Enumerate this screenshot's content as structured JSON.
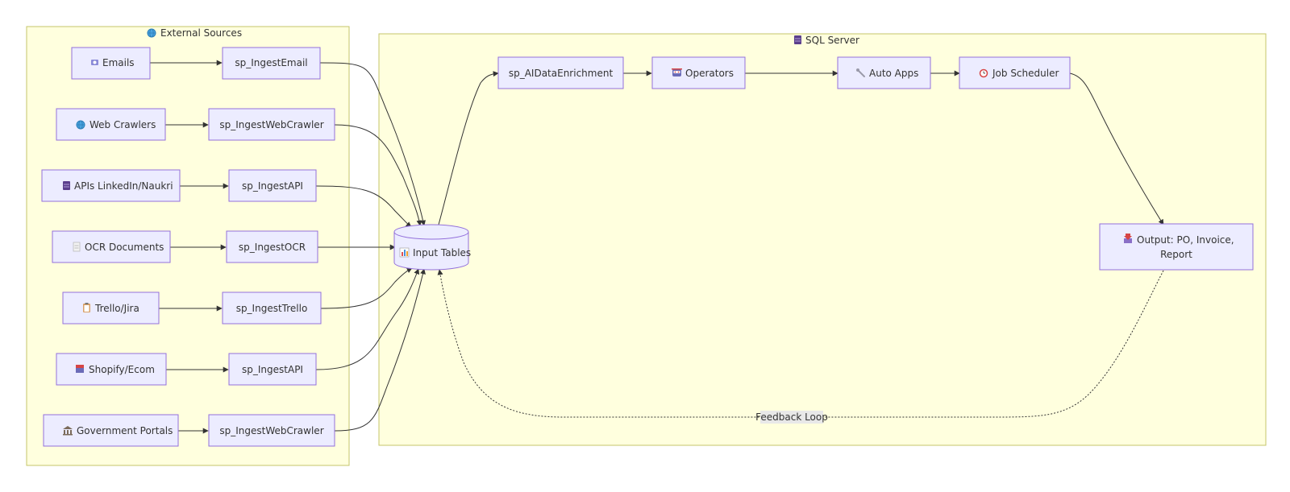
{
  "clusters": {
    "external": {
      "label": "External Sources",
      "icon": "globe-icon"
    },
    "sql": {
      "label": "SQL Server",
      "icon": "server-icon"
    }
  },
  "sources": [
    {
      "label": "Emails",
      "icon": "email-icon"
    },
    {
      "label": "Web Crawlers",
      "icon": "globe-icon"
    },
    {
      "label": "APIs LinkedIn/Naukri",
      "icon": "server-icon"
    },
    {
      "label": "OCR Documents",
      "icon": "document-icon"
    },
    {
      "label": "Trello/Jira",
      "icon": "clipboard-icon"
    },
    {
      "label": "Shopify/Ecom",
      "icon": "store-icon"
    },
    {
      "label": "Government Portals",
      "icon": "bank-icon"
    }
  ],
  "ingest": [
    {
      "label": "sp_IngestEmail"
    },
    {
      "label": "sp_IngestWebCrawler"
    },
    {
      "label": "sp_IngestAPI"
    },
    {
      "label": "sp_IngestOCR"
    },
    {
      "label": "sp_IngestTrello"
    },
    {
      "label": "sp_IngestAPI"
    },
    {
      "label": "sp_IngestWebCrawler"
    }
  ],
  "input_tables": {
    "label": "Input Tables",
    "icon": "bar-chart-icon"
  },
  "pipeline": [
    {
      "label": "sp_AIDataEnrichment"
    },
    {
      "label": "Operators",
      "icon": "robot-icon"
    },
    {
      "label": "Auto Apps",
      "icon": "wrench-icon"
    },
    {
      "label": "Job Scheduler",
      "icon": "alarm-clock-icon"
    }
  ],
  "output": {
    "line1": "Output: PO, Invoice,",
    "line2": "Report",
    "icon": "inbox-tray-icon"
  },
  "feedback": {
    "label": "Feedback Loop"
  }
}
